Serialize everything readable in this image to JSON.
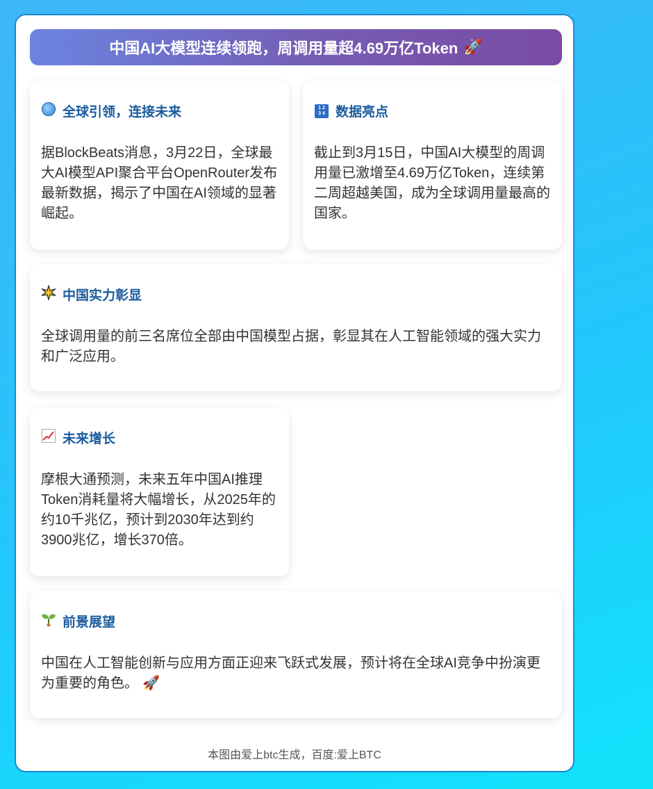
{
  "banner": {
    "title": "中国AI大模型连续领跑，周调用量超4.69万亿Token",
    "rocket": "🚀"
  },
  "sections": [
    {
      "icon": "globe-icon",
      "heading": "全球引领，连接未来",
      "body": "据BlockBeats消息，3月22日，全球最大AI模型API聚合平台OpenRouter发布最新数据，揭示了中国在AI领域的显著崛起。"
    },
    {
      "icon": "numbers-icon",
      "heading": "数据亮点",
      "body": "截止到3月15日，中国AI大模型的周调用量已激增至4.69万亿Token，连续第二周超越美国，成为全球调用量最高的国家。"
    },
    {
      "icon": "sparkle-icon",
      "heading": "中国实力彰显",
      "body": "全球调用量的前三名席位全部由中国模型占据，彰显其在人工智能领域的强大实力和广泛应用。"
    },
    {
      "icon": "chart-increasing-icon",
      "heading": "未来增长",
      "body": "摩根大通预测，未来五年中国AI推理Token消耗量将大幅增长，从2025年的约10千兆亿，预计到2030年达到约3900兆亿，增长370倍。"
    },
    {
      "icon": "seedling-icon",
      "heading": "前景展望",
      "body": "中国在人工智能创新与应用方面正迎来飞跃式发展，预计将在全球AI竞争中扮演更为重要的角色。",
      "trailing_emoji": "🚀"
    }
  ],
  "footer": "本图由爱上btc生成，百度:爱上BTC"
}
